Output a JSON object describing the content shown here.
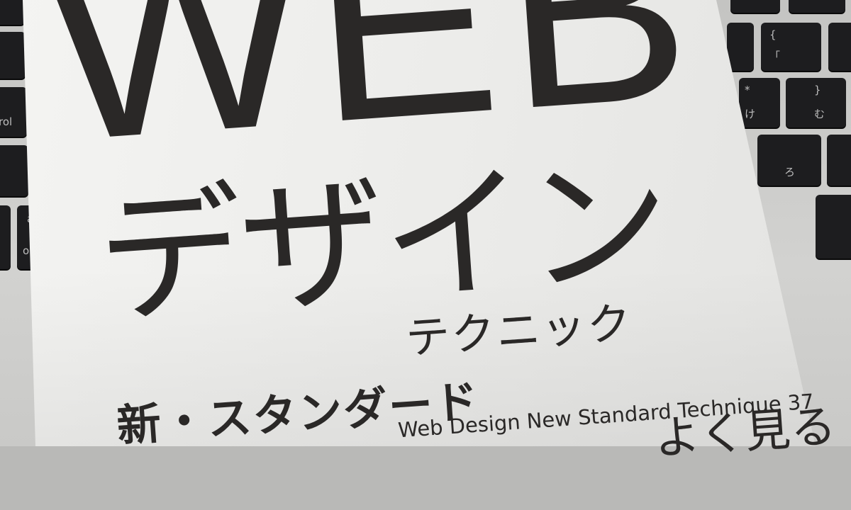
{
  "book": {
    "title_main": "WEB",
    "title_kana": "デザイン",
    "subtitle_right": "テクニック",
    "subtitle_left": "新・スタンダード",
    "english_title": "Web Design New Standard Technique 37",
    "partial_bottom": "よく見る"
  },
  "keyboard": {
    "left_keys": [
      "rol",
      "a",
      "op"
    ],
    "right_keys": [
      {
        "top": "{",
        "bottom": "「"
      },
      {
        "top": "*",
        "bottom": "け"
      },
      {
        "top": "}",
        "bottom": "む"
      },
      {
        "top": "",
        "bottom": "ろ"
      }
    ]
  },
  "colors": {
    "ink": "#2a2827",
    "cover": "#efefed",
    "key": "#1d1d1f"
  }
}
